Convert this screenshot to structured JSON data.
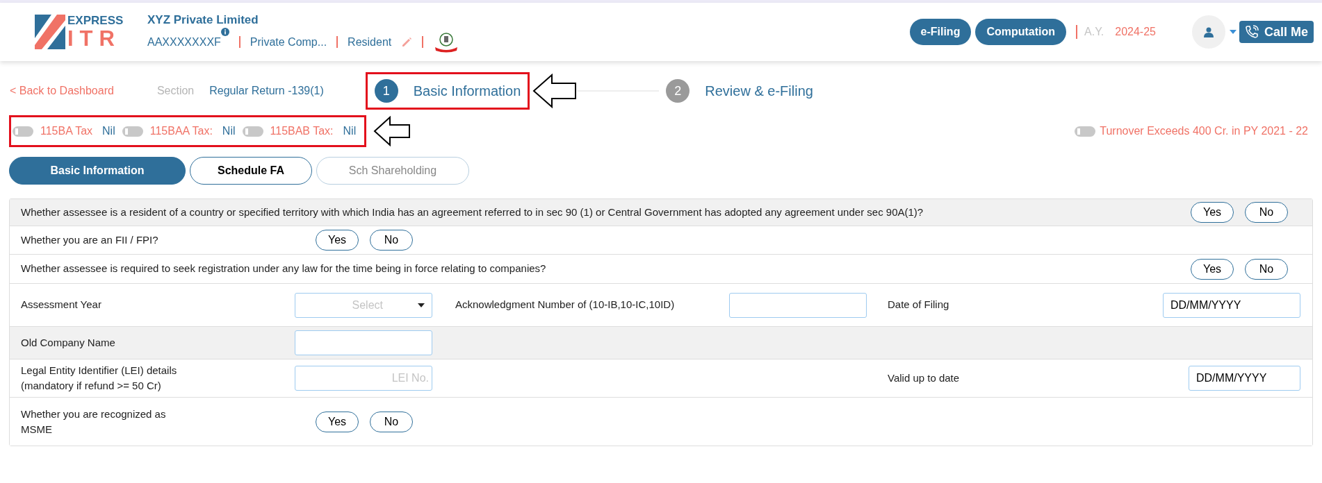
{
  "header": {
    "logo": {
      "top": "EXPRESS",
      "bottom": "ITR"
    },
    "company": {
      "name": "XYZ Private Limited",
      "pan": "AAXXXXXXXF",
      "type": "Private Comp...",
      "residency": "Resident"
    },
    "nav_buttons": [
      "e-Filing",
      "Computation"
    ],
    "ay_label": "A.Y.",
    "ay_value": "2024-25",
    "call_button": "Call Me"
  },
  "breadcrumb": {
    "back": "< Back to Dashboard",
    "section_label": "Section",
    "section_value": "Regular Return -139(1)"
  },
  "steps": [
    {
      "number": "1",
      "label": "Basic Information",
      "selected": true,
      "annotated": true
    },
    {
      "number": "2",
      "label": "Review & e-Filing",
      "selected": false,
      "annotated": false
    }
  ],
  "tax_toggles": {
    "annotated": true,
    "items": [
      {
        "label": "115BA Tax",
        "value": "Nil",
        "on": false
      },
      {
        "label": "115BAA Tax:",
        "value": "Nil",
        "on": false
      },
      {
        "label": "115BAB Tax:",
        "value": "Nil",
        "on": false
      }
    ]
  },
  "turnover_toggle": {
    "label": "Turnover Exceeds 400 Cr. in PY 2021 - 22",
    "on": false
  },
  "tabs": [
    {
      "label": "Basic Information",
      "selected": true,
      "disabled": false
    },
    {
      "label": "Schedule FA",
      "selected": false,
      "disabled": false
    },
    {
      "label": "Sch Shareholding",
      "selected": false,
      "disabled": true
    }
  ],
  "rows": [
    {
      "kind": "long_question",
      "shaded": true,
      "text": "Whether assessee is a resident of a country or specified territory with which India has an agreement referred to in sec 90 (1) or Central Government has adopted any agreement under sec 90A(1)?",
      "options": [
        {
          "label": "Yes",
          "selected": false
        },
        {
          "label": "No",
          "selected": false
        }
      ]
    },
    {
      "kind": "question",
      "shaded": false,
      "text": "Whether you are an FII / FPI?",
      "options": [
        {
          "label": "Yes",
          "selected": false
        },
        {
          "label": "No",
          "selected": false
        }
      ]
    },
    {
      "kind": "long_question",
      "shaded": false,
      "text": "Whether assessee is required to seek registration under any law for the time being in force relating to companies?",
      "options": [
        {
          "label": "Yes",
          "selected": false
        },
        {
          "label": "No",
          "selected": false
        }
      ]
    },
    {
      "kind": "fields",
      "shaded": false,
      "left": {
        "label": "Assessment Year",
        "control": {
          "kind": "select",
          "placeholder": "Select"
        }
      },
      "middle": {
        "label": "Acknowledgment Number of (10-IB,10-IC,10ID)",
        "control": {
          "kind": "input"
        }
      },
      "right": {
        "label": "Date of Filing",
        "control": {
          "kind": "date",
          "value": "DD/MM/YYYY"
        }
      }
    },
    {
      "kind": "fields",
      "shaded": true,
      "left": {
        "label": "Old Company Name",
        "control": {
          "kind": "input"
        }
      }
    },
    {
      "kind": "fields",
      "shaded": false,
      "left": {
        "label": "Legal Entity Identifier (LEI) details\n(mandatory if refund >= 50 Cr)",
        "control": {
          "kind": "input",
          "placeholder": "LEI No."
        }
      },
      "right": {
        "label": "Valid up to date",
        "control": {
          "kind": "date_short",
          "value": "DD/MM/YYYY"
        }
      }
    },
    {
      "kind": "question",
      "shaded": false,
      "text": "Whether you are recognized as\nMSME",
      "options": [
        {
          "label": "Yes",
          "selected": false
        },
        {
          "label": "No",
          "selected": false
        }
      ]
    }
  ]
}
